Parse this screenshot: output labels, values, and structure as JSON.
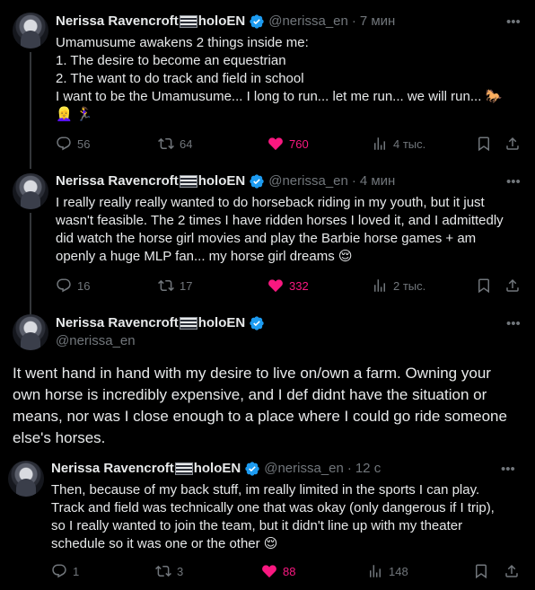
{
  "posts": [
    {
      "name": "Nerissa Ravencroft",
      "name_suffix": "holoEN",
      "handle": "@nerissa_en",
      "time": "7 мин",
      "lines": [
        "Umamusume awakens 2 things inside me:",
        "1. The desire to become an equestrian",
        "2. The want to do track and field in school",
        "I want to be the Umamusume... I long to run... let me run... we will run... 🐎",
        "👱‍♀️ 🏃‍♀️"
      ],
      "replies": "56",
      "reposts": "64",
      "likes": "760",
      "views": "4 тыс."
    },
    {
      "name": "Nerissa Ravencroft",
      "name_suffix": "holoEN",
      "handle": "@nerissa_en",
      "time": "4 мин",
      "lines": [
        "I really really really wanted to do horseback riding in my youth, but it just",
        "wasn't feasible. The 2 times I have ridden horses I loved it, and I admittedly",
        "did watch the horse girl movies and play the Barbie horse games + am",
        "openly a huge MLP fan... my horse girl dreams 😌"
      ],
      "replies": "16",
      "reposts": "17",
      "likes": "332",
      "views": "2 тыс."
    },
    {
      "name": "Nerissa Ravencroft",
      "name_suffix": "holoEN",
      "handle": "@nerissa_en",
      "lines": [
        "It went hand in hand with my desire to live on/own a farm. Owning your",
        "own horse is incredibly expensive, and I def didnt have the situation or",
        "means, nor was I close enough to a place where I could go ride someone",
        "else's horses."
      ]
    },
    {
      "name": "Nerissa Ravencroft",
      "name_suffix": "holoEN",
      "handle": "@nerissa_en",
      "time": "12 с",
      "lines": [
        "Then, because of my back stuff, im really limited in the sports I can play.",
        "Track and field was technically one that was okay (only dangerous if I trip),",
        "so I really wanted to join the team, but it didn't line up with my theater",
        "schedule so it was one or the other 😌"
      ],
      "replies": "1",
      "reposts": "3",
      "likes": "88",
      "views": "148"
    }
  ],
  "colors": {
    "background": "#000000",
    "text": "#e7e9ea",
    "secondary": "#71767b",
    "like": "#f91880",
    "verified": "#1d9bf0"
  }
}
